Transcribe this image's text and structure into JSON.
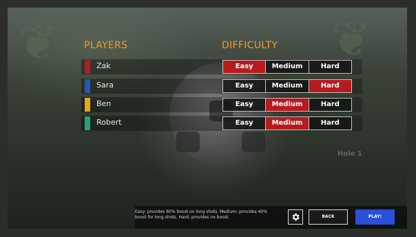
{
  "headers": {
    "players": "PLAYERS",
    "difficulty": "DIFFICULTY"
  },
  "difficulty_options": [
    "Easy",
    "Medium",
    "Hard"
  ],
  "players": [
    {
      "name": "Zak",
      "color": "#b01e22",
      "difficulty": "Easy"
    },
    {
      "name": "Sara",
      "color": "#2a55b8",
      "difficulty": "Hard"
    },
    {
      "name": "Ben",
      "color": "#e6a91c",
      "difficulty": "Medium"
    },
    {
      "name": "Robert",
      "color": "#27a080",
      "difficulty": "Medium"
    }
  ],
  "hint_text": "Easy: provides 80% boost on long shots. Medium: provides 40% boost for long shots. Hard: provides no boost.",
  "background_label": "Hole 1",
  "buttons": {
    "back": "BACK",
    "play": "PLAY!",
    "settings_icon": "gear-icon"
  },
  "colors": {
    "accent": "#f29a22",
    "selected": "#b51b1f",
    "play": "#2a4fd8"
  }
}
